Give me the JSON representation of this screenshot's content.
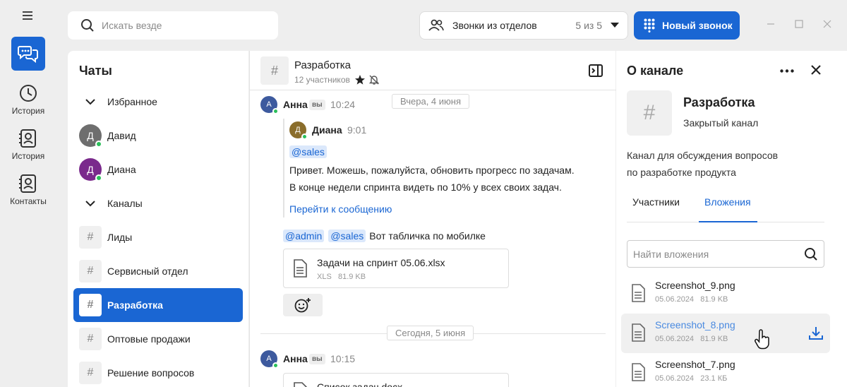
{
  "rail": {
    "items": [
      {
        "label": "История",
        "icon": "clock-icon"
      },
      {
        "label": "История",
        "icon": "contact-card-icon"
      },
      {
        "label": "Контакты",
        "icon": "contact-card-icon"
      }
    ]
  },
  "search": {
    "placeholder": "Искать везде"
  },
  "dept": {
    "label": "Звонки из отделов",
    "count": "5 из 5"
  },
  "new_call": {
    "label": "Новый звонок"
  },
  "chatlist": {
    "title": "Чаты",
    "rows": [
      {
        "kind": "section",
        "label": "Избранное"
      },
      {
        "kind": "user",
        "label": "Давид",
        "initial": "Д",
        "color": "#6e6e6e"
      },
      {
        "kind": "user",
        "label": "Диана",
        "initial": "Д",
        "color": "#7a2a8c"
      },
      {
        "kind": "section",
        "label": "Каналы"
      },
      {
        "kind": "channel",
        "label": "Лиды"
      },
      {
        "kind": "channel",
        "label": "Сервисный отдел"
      },
      {
        "kind": "channel",
        "label": "Разработка",
        "active": true
      },
      {
        "kind": "channel",
        "label": "Оптовые продажи"
      },
      {
        "kind": "channel",
        "label": "Решение вопросов"
      }
    ]
  },
  "chat": {
    "title": "Разработка",
    "participants": "12 участников",
    "date1": "Вчера, 4 июня",
    "date2": "Сегодня, 5 июня",
    "msg1": {
      "author": "Анна",
      "badge": "вы",
      "time": "10:24",
      "initial": "А",
      "quote": {
        "author": "Диана",
        "time": "9:01",
        "initial": "Д",
        "mention": "@sales",
        "line1": "Привет. Можешь, пожалуйста, обновить прогресс по задачам.",
        "line2": "В конце недели спринта видеть по 10% у всех своих задач.",
        "link": "Перейти к сообщению"
      },
      "mention1": "@admin",
      "mention2": "@sales",
      "text": "Вот табличка по мобилке",
      "file": {
        "name": "Задачи на спринт 05.06.xlsx",
        "type": "XLS",
        "size": "81.9 KB"
      }
    },
    "msg2": {
      "author": "Анна",
      "badge": "вы",
      "time": "10:15",
      "initial": "А",
      "file": {
        "name": "Список задач.docx"
      }
    }
  },
  "info": {
    "title": "О канале",
    "name": "Разработка",
    "type": "Закрытый канал",
    "description_line1": "Канал для обсуждения вопросов",
    "description_line2": "по разработке продукта",
    "tabs": [
      "Участники",
      "Вложения"
    ],
    "attachments_placeholder": "Найти вложения",
    "attachments": [
      {
        "name": "Screenshot_9.png",
        "date": "05.06.2024",
        "size": "81.9 KB"
      },
      {
        "name": "Screenshot_8.png",
        "date": "05.06.2024",
        "size": "81.9 KB"
      },
      {
        "name": "Screenshot_7.png",
        "date": "05.06.2024",
        "size": "23.1 КБ"
      }
    ]
  },
  "colors": {
    "accent": "#1a66d3",
    "online": "#2bbf5a",
    "avatar_anna": "#3d5a9e",
    "avatar_diana_quote": "#8a6d2b"
  }
}
